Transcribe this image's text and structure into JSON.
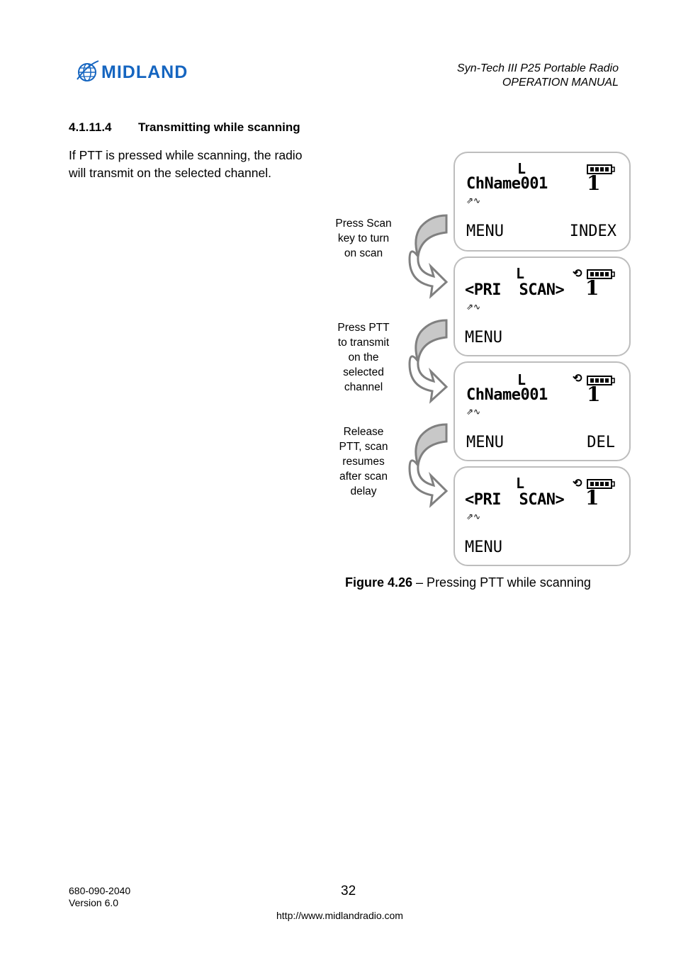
{
  "header": {
    "brand": "MIDLAND",
    "product_title": "Syn-Tech III P25 Portable Radio",
    "manual_title": "OPERATION MANUAL"
  },
  "section": {
    "number": "4.1.11.4",
    "title": "Transmitting while scanning",
    "body": "If PTT is pressed while scanning, the radio will transmit on the selected channel."
  },
  "figure": {
    "steps": [
      {
        "label_lines": [
          "Press Scan",
          "key to turn",
          "on scan"
        ]
      },
      {
        "label_lines": [
          "Press PTT",
          "to transmit",
          "on the",
          "selected",
          "channel"
        ]
      },
      {
        "label_lines": [
          "Release",
          "PTT, scan",
          "resumes",
          "after scan",
          "delay"
        ]
      }
    ],
    "screens": [
      {
        "power": "L",
        "line": "ChName001",
        "channel": "1",
        "scan_icon": false,
        "softkey_left": "MENU",
        "softkey_right": "INDEX",
        "battery_bars": 4
      },
      {
        "power": "L",
        "line": "<PRI  SCAN>",
        "channel": "1",
        "scan_icon": true,
        "softkey_left": "MENU",
        "softkey_right": "",
        "battery_bars": 4
      },
      {
        "power": "L",
        "line": "ChName001",
        "channel": "1",
        "scan_icon": true,
        "softkey_left": "MENU",
        "softkey_right": "DEL",
        "battery_bars": 4
      },
      {
        "power": "L",
        "line": "<PRI  SCAN>",
        "channel": "1",
        "scan_icon": true,
        "softkey_left": "MENU",
        "softkey_right": "",
        "battery_bars": 4
      }
    ],
    "caption_bold": "Figure 4.26",
    "caption_rest": " – Pressing PTT while scanning"
  },
  "footer": {
    "doc_number": "680-090-2040",
    "version": "Version 6.0",
    "page_number": "32",
    "url": "http://www.midlandradio.com"
  }
}
